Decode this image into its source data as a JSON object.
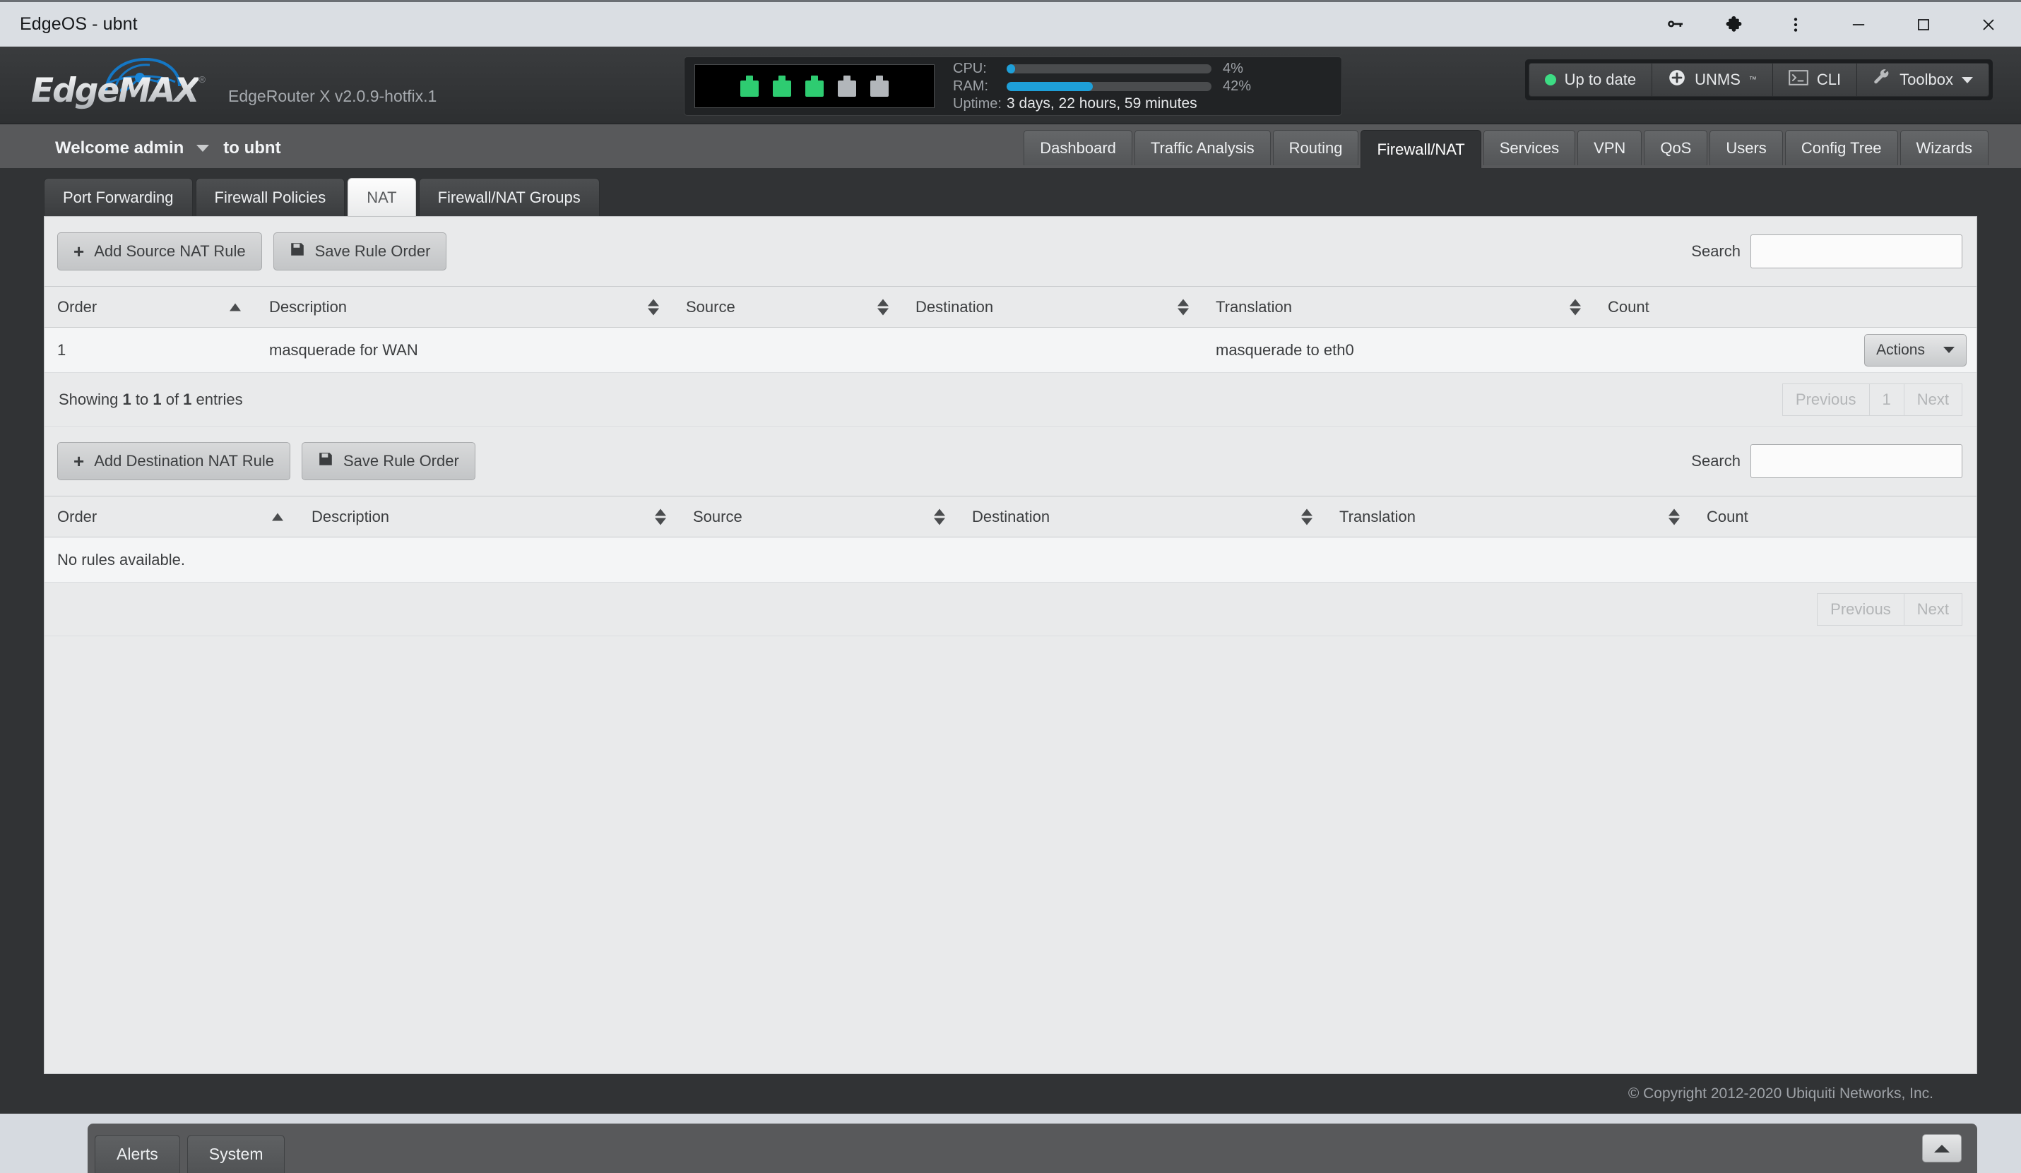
{
  "browser": {
    "title": "EdgeOS - ubnt",
    "icons": {
      "password_key": "key-icon",
      "extensions": "puzzle-icon",
      "menu": "kebab-menu-icon",
      "minimize": "minimize-icon",
      "maximize": "maximize-icon",
      "close": "close-icon"
    }
  },
  "header": {
    "logo_text": "EdgeMAX",
    "logo_registered": "®",
    "device_model": "EdgeRouter X v2.0.9-hotfix.1",
    "ports": [
      {
        "state": "on"
      },
      {
        "state": "on"
      },
      {
        "state": "on"
      },
      {
        "state": "off"
      },
      {
        "state": "off"
      }
    ],
    "stats": {
      "cpu_label": "CPU:",
      "cpu_pct": "4%",
      "cpu_value": 4,
      "ram_label": "RAM:",
      "ram_pct": "42%",
      "ram_value": 42,
      "uptime_label": "Uptime:",
      "uptime_value": "3 days, 22 hours, 59 minutes"
    },
    "actions": {
      "status_label": "Up to date",
      "status_color": "#3ddc84",
      "unms_label": "UNMS",
      "unms_tm": "™",
      "cli_label": "CLI",
      "toolbox_label": "Toolbox"
    }
  },
  "nav": {
    "welcome_user": "Welcome admin",
    "welcome_to": "to ubnt",
    "tabs": [
      {
        "label": "Dashboard",
        "active": false
      },
      {
        "label": "Traffic Analysis",
        "active": false
      },
      {
        "label": "Routing",
        "active": false
      },
      {
        "label": "Firewall/NAT",
        "active": true
      },
      {
        "label": "Services",
        "active": false
      },
      {
        "label": "VPN",
        "active": false
      },
      {
        "label": "QoS",
        "active": false
      },
      {
        "label": "Users",
        "active": false
      },
      {
        "label": "Config Tree",
        "active": false
      },
      {
        "label": "Wizards",
        "active": false
      }
    ]
  },
  "subtabs": [
    {
      "label": "Port Forwarding",
      "active": false
    },
    {
      "label": "Firewall Policies",
      "active": false
    },
    {
      "label": "NAT",
      "active": true
    },
    {
      "label": "Firewall/NAT Groups",
      "active": false
    }
  ],
  "source_nat": {
    "add_button": "Add Source NAT Rule",
    "save_button": "Save Rule Order",
    "search_label": "Search",
    "search_value": "",
    "search_placeholder": "",
    "columns": [
      {
        "label": "Order",
        "sort": "asc"
      },
      {
        "label": "Description",
        "sort": "both"
      },
      {
        "label": "Source",
        "sort": "both"
      },
      {
        "label": "Destination",
        "sort": "both"
      },
      {
        "label": "Translation",
        "sort": "both"
      },
      {
        "label": "Count",
        "sort": "none"
      }
    ],
    "rows": [
      {
        "order": "1",
        "description": "masquerade for WAN",
        "source": "",
        "destination": "",
        "translation": "masquerade to eth0",
        "count": "",
        "actions_label": "Actions"
      }
    ],
    "showing_prefix": "Showing ",
    "showing_from": "1",
    "showing_mid1": " to ",
    "showing_to": "1",
    "showing_mid2": " of ",
    "showing_total": "1",
    "showing_suffix": " entries",
    "pager": [
      "Previous",
      "1",
      "Next"
    ]
  },
  "destination_nat": {
    "add_button": "Add Destination NAT Rule",
    "save_button": "Save Rule Order",
    "search_label": "Search",
    "search_value": "",
    "search_placeholder": "",
    "columns": [
      {
        "label": "Order",
        "sort": "asc"
      },
      {
        "label": "Description",
        "sort": "both"
      },
      {
        "label": "Source",
        "sort": "both"
      },
      {
        "label": "Destination",
        "sort": "both"
      },
      {
        "label": "Translation",
        "sort": "both"
      },
      {
        "label": "Count",
        "sort": "none"
      }
    ],
    "empty_message": "No rules available.",
    "pager": [
      "Previous",
      "Next"
    ]
  },
  "footer": {
    "copyright": "© Copyright 2012-2020 Ubiquiti Networks, Inc."
  },
  "dock": {
    "tabs": [
      {
        "label": "Alerts"
      },
      {
        "label": "System"
      }
    ],
    "collapse_icon": "chevron-up-icon"
  }
}
